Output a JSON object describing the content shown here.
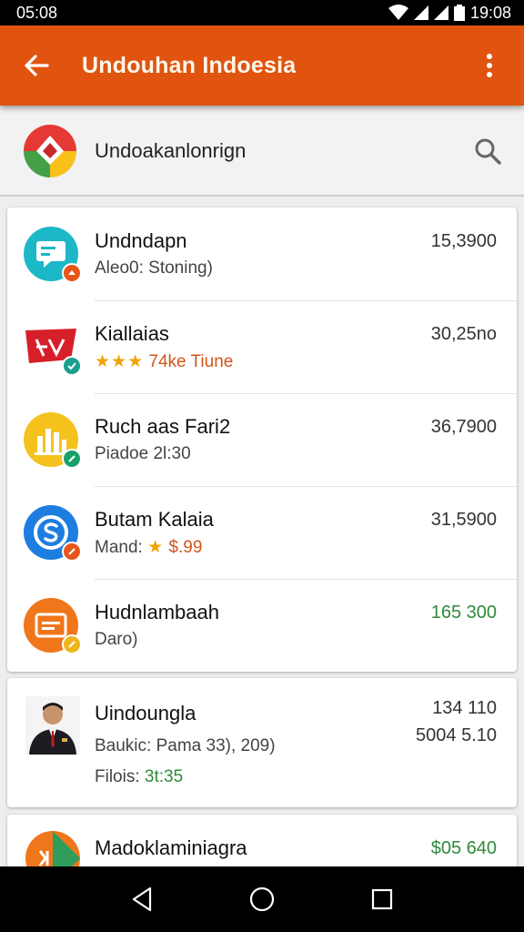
{
  "status": {
    "time_left": "05:08",
    "time_right": "19:08"
  },
  "header": {
    "title": "Undouhan Indoesia",
    "back_icon": "arrow-left-icon",
    "more_icon": "more-vert-icon"
  },
  "search": {
    "text": "Undoakanlonrign",
    "icon": "search-icon"
  },
  "list": [
    {
      "name": "Undndapn",
      "sub": "Aleo0: Stoning)",
      "price": "15,3900",
      "icon_color": "#1cb8c8",
      "badge_color": "#e8551a"
    },
    {
      "name": "Kiallaias",
      "stars": "★★★",
      "sub": "74ke Tiune",
      "price": "30,25no",
      "icon_color": "#d71f2a",
      "badge_color": "#1aa08c"
    },
    {
      "name": "Ruch aas Fari2",
      "sub": "Piadoe 2l:30",
      "price": "36,7900",
      "icon_color": "#f5c21d",
      "badge_color": "#1aa06a"
    },
    {
      "name": "Butam Kalaia",
      "sub_prefix": "Mand:",
      "star": "★",
      "sub": "$.99",
      "price": "31,5900",
      "icon_color": "#1d7de0",
      "badge_color": "#e8551a"
    },
    {
      "name": "Hudnlambaah",
      "sub": "Daro)",
      "price": "165 300",
      "icon_color": "#f0761c",
      "badge_color": "#f0b41c"
    }
  ],
  "card2": {
    "name": "Uindoungla",
    "sub": "Baukic: Pama 33), 209)",
    "price1": "134 110",
    "price2": "5004 5.10",
    "foot_label": "Filois:",
    "foot_value": "3t:35"
  },
  "card3": {
    "name": "Madoklaminiagra",
    "price": "$05 640"
  },
  "nav": {
    "back": "nav-back-icon",
    "home": "nav-home-icon",
    "recents": "nav-recents-icon"
  }
}
